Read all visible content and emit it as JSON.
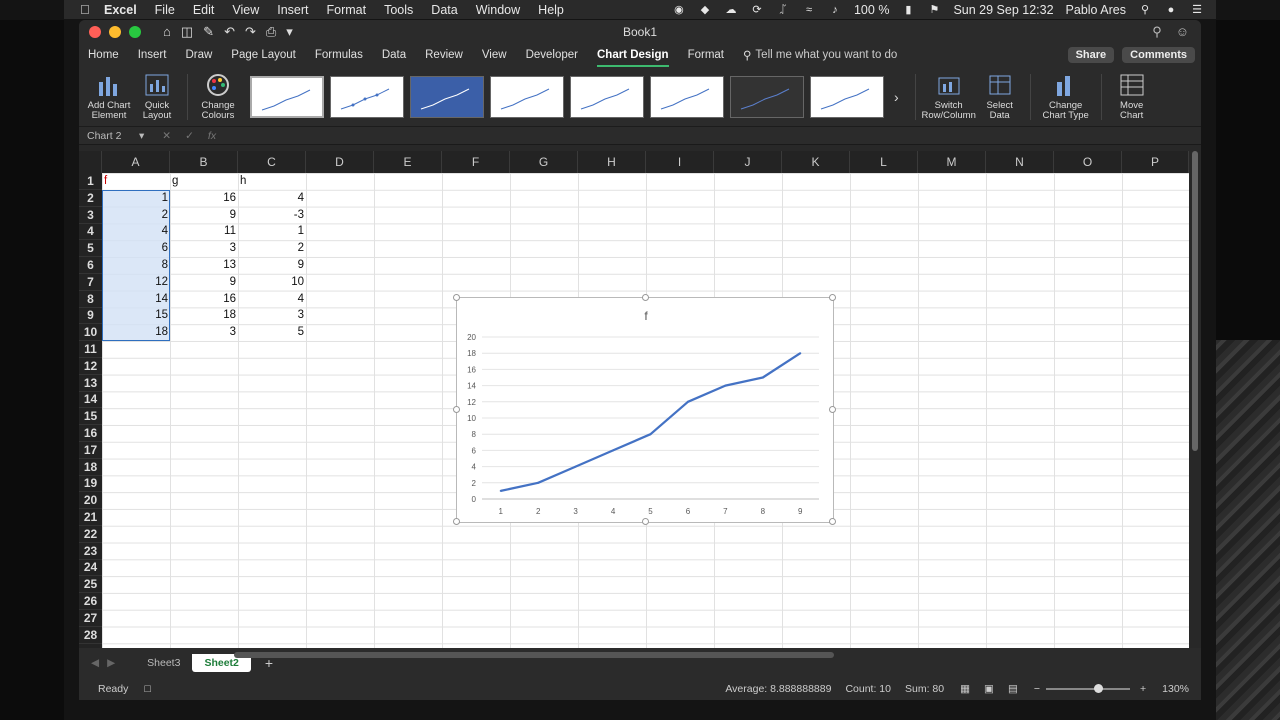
{
  "menubar": {
    "app": "Excel",
    "items": [
      "File",
      "Edit",
      "View",
      "Insert",
      "Format",
      "Tools",
      "Data",
      "Window",
      "Help"
    ],
    "battery": "100 %",
    "datetime": "Sun 29 Sep  12:32",
    "user": "Pablo Ares"
  },
  "window": {
    "title": "Book1"
  },
  "ribbon_tabs": [
    "Home",
    "Insert",
    "Draw",
    "Page Layout",
    "Formulas",
    "Data",
    "Review",
    "View",
    "Developer",
    "Chart Design",
    "Format"
  ],
  "active_tab": "Chart Design",
  "tellme": "Tell me what you want to do",
  "share_label": "Share",
  "comments_label": "Comments",
  "ribbon": {
    "add_chart_element": [
      "Add Chart",
      "Element"
    ],
    "quick_layout": [
      "Quick",
      "Layout"
    ],
    "change_colours": [
      "Change",
      "Colours"
    ],
    "switch_row_col": [
      "Switch",
      "Row/Column"
    ],
    "select_data": [
      "Select",
      "Data"
    ],
    "change_chart_type": [
      "Change",
      "Chart Type"
    ],
    "move_chart": [
      "Move",
      "Chart"
    ]
  },
  "namebox": "Chart 2",
  "columns": [
    "A",
    "B",
    "C",
    "D",
    "E",
    "F",
    "G",
    "H",
    "I",
    "J",
    "K",
    "L",
    "M",
    "N",
    "O",
    "P"
  ],
  "rows": [
    "1",
    "2",
    "3",
    "4",
    "5",
    "6",
    "7",
    "8",
    "9",
    "10",
    "11",
    "12",
    "13",
    "14",
    "15",
    "16",
    "17",
    "18",
    "19",
    "20",
    "21",
    "22",
    "23",
    "24",
    "25",
    "26",
    "27",
    "28"
  ],
  "cells": {
    "headers": [
      "f",
      "g",
      "h"
    ],
    "colA": [
      "1",
      "2",
      "4",
      "6",
      "8",
      "12",
      "14",
      "15",
      "18"
    ],
    "colB": [
      "16",
      "9",
      "11",
      "3",
      "13",
      "9",
      "16",
      "18",
      "3"
    ],
    "colC": [
      "4",
      "-3",
      "1",
      "2",
      "9",
      "10",
      "4",
      "3",
      "5"
    ]
  },
  "chart_data": {
    "type": "line",
    "title": "f",
    "categories": [
      "1",
      "2",
      "3",
      "4",
      "5",
      "6",
      "7",
      "8",
      "9"
    ],
    "series": [
      {
        "values": [
          1,
          2,
          4,
          6,
          8,
          12,
          14,
          15,
          18
        ],
        "color": "#4472c4"
      }
    ],
    "yticks": [
      "0",
      "2",
      "4",
      "6",
      "8",
      "10",
      "12",
      "14",
      "16",
      "18",
      "20"
    ],
    "ylim": [
      0,
      20
    ],
    "grid": true
  },
  "sheet_tabs": [
    "Sheet3",
    "Sheet2"
  ],
  "active_sheet": "Sheet2",
  "status": {
    "ready": "Ready",
    "average": "Average: 8.888888889",
    "count": "Count: 10",
    "sum": "Sum: 80",
    "zoom": "130%"
  }
}
